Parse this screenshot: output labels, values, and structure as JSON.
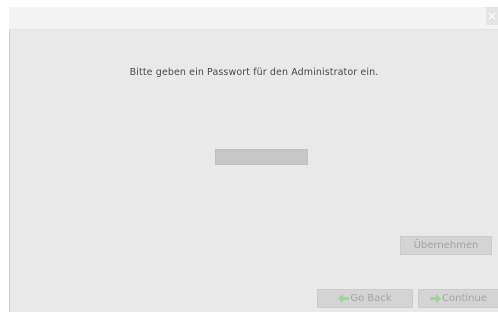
{
  "window": {
    "close_glyph": "×"
  },
  "main": {
    "prompt": "Bitte geben ein Passwort für den Administrator ein.",
    "password_value": ""
  },
  "buttons": {
    "apply_label": "Übernehmen",
    "back_label": "Go Back",
    "continue_label": "Continue",
    "arrow_color": "#9ed49a"
  }
}
